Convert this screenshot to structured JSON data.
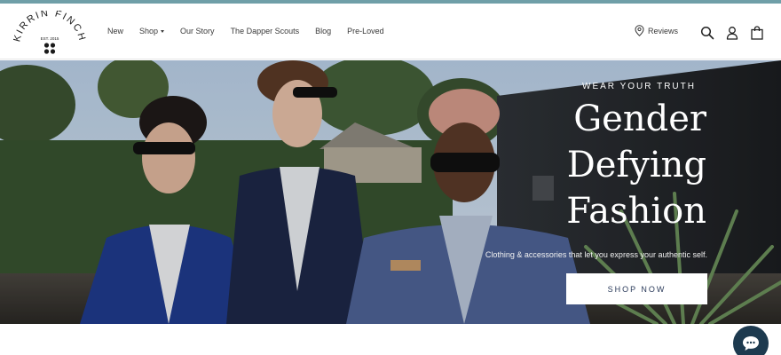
{
  "brand": {
    "logo_text": "KIRRIN FINCH",
    "est": "EST. 2015",
    "accent_color": "#6f9fa8"
  },
  "nav": {
    "items": [
      {
        "label": "New"
      },
      {
        "label": "Shop",
        "has_dropdown": true
      },
      {
        "label": "Our Story"
      },
      {
        "label": "The Dapper Scouts"
      },
      {
        "label": "Blog"
      },
      {
        "label": "Pre-Loved"
      }
    ]
  },
  "header_actions": {
    "reviews_label": "Reviews",
    "reviews_icon": "location-pin-icon",
    "search_icon": "search-icon",
    "account_icon": "user-icon",
    "cart_icon": "shopping-bag-icon"
  },
  "hero": {
    "kicker": "WEAR YOUR TRUTH",
    "title_lines": [
      "Gender",
      "Defying",
      "Fashion"
    ],
    "subtitle": "Clothing & accessories that let you express your authentic self.",
    "cta_label": "SHOP NOW"
  },
  "chat": {
    "icon": "chat-icon",
    "color": "#1d3a4f"
  }
}
